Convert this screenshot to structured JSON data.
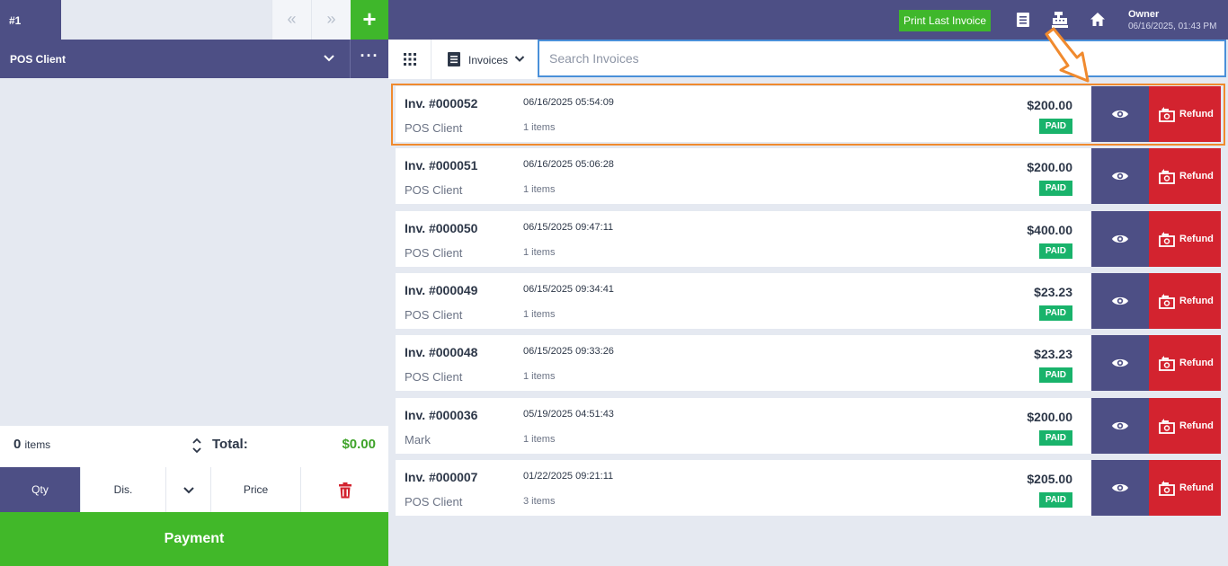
{
  "cart": {
    "tab_label": "#1",
    "prev_glyph": "«",
    "next_glyph": "»",
    "add_glyph": "+",
    "client_name": "POS Client",
    "more_glyph": "···",
    "items_count": "0",
    "items_word": "items",
    "total_label": "Total:",
    "total_value": "$0.00",
    "qty_label": "Qty",
    "dis_label": "Dis.",
    "price_label": "Price",
    "payment_label": "Payment"
  },
  "header": {
    "print_last_label": "Print Last Invoice",
    "user_name": "Owner",
    "user_datetime": "06/16/2025, 01:43 PM"
  },
  "toolbar": {
    "invoices_label": "Invoices",
    "search_placeholder": "Search Invoices",
    "search_value": ""
  },
  "invoices": [
    {
      "number": "Inv. #000052",
      "datetime": "06/16/2025  05:54:09",
      "client": "POS Client",
      "items": "1 items",
      "amount": "$200.00",
      "status": "PAID"
    },
    {
      "number": "Inv. #000051",
      "datetime": "06/16/2025  05:06:28",
      "client": "POS Client",
      "items": "1 items",
      "amount": "$200.00",
      "status": "PAID"
    },
    {
      "number": "Inv. #000050",
      "datetime": "06/15/2025  09:47:11",
      "client": "POS Client",
      "items": "1 items",
      "amount": "$400.00",
      "status": "PAID"
    },
    {
      "number": "Inv. #000049",
      "datetime": "06/15/2025  09:34:41",
      "client": "POS Client",
      "items": "1 items",
      "amount": "$23.23",
      "status": "PAID"
    },
    {
      "number": "Inv. #000048",
      "datetime": "06/15/2025  09:33:26",
      "client": "POS Client",
      "items": "1 items",
      "amount": "$23.23",
      "status": "PAID"
    },
    {
      "number": "Inv. #000036",
      "datetime": "05/19/2025  04:51:43",
      "client": "Mark",
      "items": "1 items",
      "amount": "$200.00",
      "status": "PAID"
    },
    {
      "number": "Inv. #000007",
      "datetime": "01/22/2025  09:21:11",
      "client": "POS Client",
      "items": "3 items",
      "amount": "$205.00",
      "status": "PAID"
    }
  ],
  "refund_label": "Refund",
  "colors": {
    "primary": "#4d4f85",
    "success": "#41b829",
    "danger": "#d3232f",
    "paid_badge": "#19b36b",
    "highlight": "#f08a2e",
    "focus": "#4a90d9"
  },
  "icons": [
    "plus-icon",
    "chevron-down-icon",
    "more-dots-icon",
    "sort-icon",
    "trash-icon",
    "list-icon",
    "cash-register-icon",
    "home-icon",
    "grid-icon",
    "document-icon",
    "eye-icon",
    "refund-money-icon"
  ]
}
